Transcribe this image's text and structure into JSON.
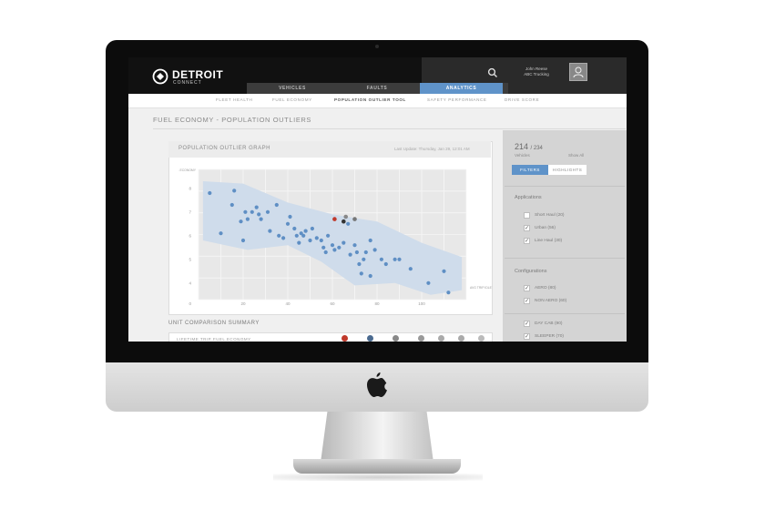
{
  "header": {
    "brand": "DETROIT",
    "brand_sub": "CONNECT",
    "user_name": "John Reese",
    "user_company": "ABC Trucking",
    "icons": [
      "logo-icon",
      "search-icon",
      "user-icon"
    ]
  },
  "main_tabs": [
    {
      "label": "VEHICLES"
    },
    {
      "label": "FAULTS"
    },
    {
      "label": "ANALYTICS",
      "active": true
    }
  ],
  "subnav": [
    {
      "label": "FLEET HEALTH"
    },
    {
      "label": "FUEL ECONOMY"
    },
    {
      "label": "POPULATION OUTLIER TOOL",
      "active": true
    },
    {
      "label": "SAFETY PERFORMANCE"
    },
    {
      "label": "DRIVE SCORE"
    }
  ],
  "page_title": "FUEL ECONOMY - POPULATION OUTLIERS",
  "graph": {
    "title": "POPULATION OUTLIER GRAPH",
    "last_update": "Last Update: Thursday, Jan 29, 12:01 AM"
  },
  "chart_data": {
    "type": "scatter",
    "ylabel": "AVG TRIP FUEL ECONOMY",
    "xlabel": "AVG TRIP IDLE TIME",
    "y_ticks": [
      "8",
      "7",
      "6",
      "5",
      "4",
      "0"
    ],
    "x_ticks": [
      "20",
      "40",
      "60",
      "80",
      "100"
    ],
    "xlim": [
      0,
      120
    ],
    "ylim": [
      3.3,
      8.8
    ],
    "grid": true,
    "points": [
      [
        5,
        7.8
      ],
      [
        10,
        6.1
      ],
      [
        16,
        7.9
      ],
      [
        15,
        7.3
      ],
      [
        19,
        6.6
      ],
      [
        20,
        5.8
      ],
      [
        21,
        7.0
      ],
      [
        22,
        6.7
      ],
      [
        24,
        7.0
      ],
      [
        26,
        7.2
      ],
      [
        27,
        6.9
      ],
      [
        28,
        6.7
      ],
      [
        31,
        7.0
      ],
      [
        32,
        6.2
      ],
      [
        35,
        7.3
      ],
      [
        36,
        6.0
      ],
      [
        38,
        5.9
      ],
      [
        40,
        6.5
      ],
      [
        41,
        6.8
      ],
      [
        43,
        6.3
      ],
      [
        44,
        6.0
      ],
      [
        45,
        5.7
      ],
      [
        46,
        6.1
      ],
      [
        47,
        6.0
      ],
      [
        48,
        6.2
      ],
      [
        50,
        5.8
      ],
      [
        51,
        6.3
      ],
      [
        53,
        5.9
      ],
      [
        55,
        5.8
      ],
      [
        56,
        5.5
      ],
      [
        57,
        5.3
      ],
      [
        58,
        6.0
      ],
      [
        60,
        5.6
      ],
      [
        61,
        5.4
      ],
      [
        63,
        5.5
      ],
      [
        65,
        5.7
      ],
      [
        67,
        6.5
      ],
      [
        68,
        5.2
      ],
      [
        70,
        5.6
      ],
      [
        71,
        5.3
      ],
      [
        72,
        4.8
      ],
      [
        74,
        5.0
      ],
      [
        75,
        5.3
      ],
      [
        77,
        5.8
      ],
      [
        79,
        5.4
      ],
      [
        82,
        5.0
      ],
      [
        84,
        4.8
      ],
      [
        88,
        5.0
      ],
      [
        90,
        5.0
      ],
      [
        95,
        4.6
      ],
      [
        103,
        4.0
      ],
      [
        110,
        4.5
      ],
      [
        73,
        4.4
      ],
      [
        77,
        4.3
      ],
      [
        112,
        3.6
      ]
    ],
    "highlight_points": [
      [
        61,
        6.7
      ],
      [
        66,
        6.8
      ],
      [
        65,
        6.6
      ],
      [
        70,
        6.7
      ]
    ],
    "band_color": "#cfdceb",
    "point_color": "#5f8fc4"
  },
  "summary": {
    "title": "UNIT COMPARISON SUMMARY",
    "row_label": "LIFETIME TRIP FUEL ECONOMY"
  },
  "panel": {
    "count": "214",
    "total": "/ 234",
    "vehicles_label": "Vehicles",
    "show_all": "Show All",
    "filters_label": "FILTERS",
    "highlights_label": "HIGHLIGHTS",
    "applications_title": "Applications",
    "applications": [
      {
        "label": "Short Haul (20)",
        "checked": false
      },
      {
        "label": "Urban (56)",
        "checked": true
      },
      {
        "label": "Line Haul (30)",
        "checked": true
      }
    ],
    "configurations_title": "Configurations",
    "configurations": [
      {
        "label": "AERO (80)",
        "checked": true
      },
      {
        "label": "NON AERO (60)",
        "checked": true
      },
      {
        "label": "DAY CAB (90)",
        "checked": true
      },
      {
        "label": "SLEEPER (70)",
        "checked": true
      }
    ]
  },
  "colors": {
    "accent": "#5f93c9",
    "topbar": "#111111"
  }
}
